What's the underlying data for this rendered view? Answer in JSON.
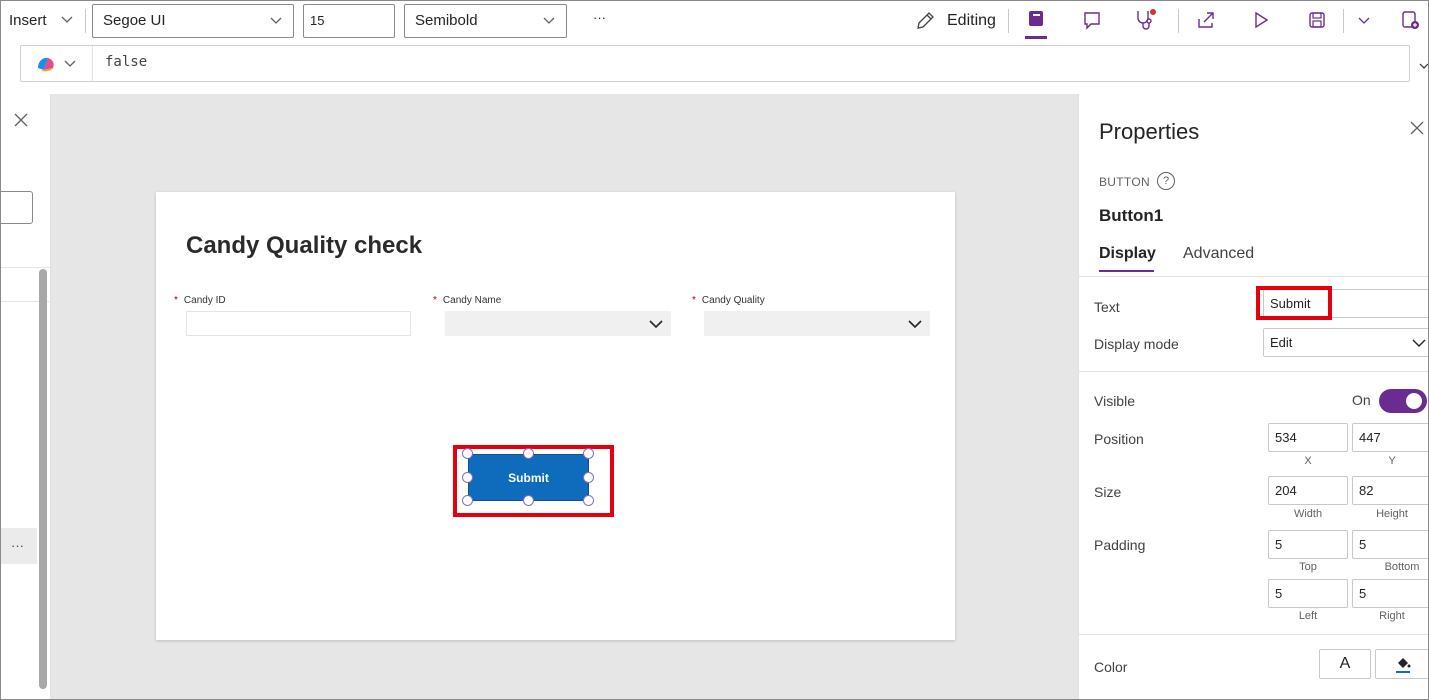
{
  "toolbar": {
    "insert_label": "Insert",
    "font_family": "Segoe UI",
    "font_size": "15",
    "font_weight": "Semibold",
    "more_label": "···",
    "editing_label": "Editing"
  },
  "formula": {
    "value": "false"
  },
  "canvas": {
    "screen_title": "Candy Quality check",
    "fields": [
      {
        "label": "Candy ID",
        "required_mark": "*"
      },
      {
        "label": "Candy Name",
        "required_mark": "*"
      },
      {
        "label": "Candy Quality",
        "required_mark": "*"
      }
    ],
    "submit_label": "Submit"
  },
  "left_panel": {
    "more_label": "···"
  },
  "properties": {
    "title": "Properties",
    "control_type": "BUTTON",
    "help_mark": "?",
    "control_name": "Button1",
    "tabs": [
      "Display",
      "Advanced"
    ],
    "text_label": "Text",
    "text_value": "Submit",
    "display_mode_label": "Display mode",
    "display_mode_value": "Edit",
    "visible_label": "Visible",
    "visible_state": "On",
    "position_label": "Position",
    "position_x": "534",
    "position_y": "447",
    "x_label": "X",
    "y_label": "Y",
    "size_label": "Size",
    "width_value": "204",
    "height_value": "82",
    "width_label": "Width",
    "height_label": "Height",
    "padding_label": "Padding",
    "padding_top": "5",
    "padding_bottom": "5",
    "padding_left": "5",
    "padding_right": "5",
    "top_label": "Top",
    "bottom_label": "Bottom",
    "left_label": "Left",
    "right_label": "Right",
    "color_label": "Color",
    "color_text_glyph": "A"
  },
  "colors": {
    "accent": "#6b2c91",
    "button": "#0f6cbd",
    "highlight": "#e3000f"
  }
}
